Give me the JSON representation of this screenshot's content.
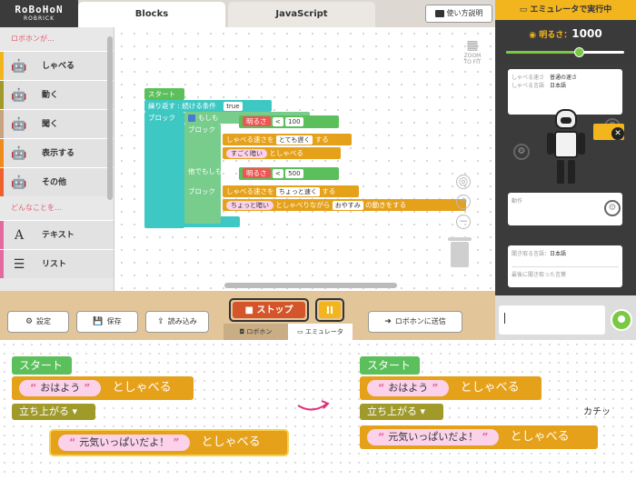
{
  "header": {
    "logo": "RoBoHoN",
    "logo_sub": "ROBRICK",
    "tabs": [
      "Blocks",
      "JavaScript"
    ],
    "howto": "使い方説明"
  },
  "sidebar": {
    "group1": "ロボホンが…",
    "items": [
      {
        "label": "しゃべる",
        "color": "#f3b51d",
        "icon": "robot-talk-icon"
      },
      {
        "label": "動く",
        "color": "#a09a2b",
        "icon": "robot-move-icon"
      },
      {
        "label": "聞く",
        "color": "#c9a37f",
        "icon": "robot-listen-icon"
      },
      {
        "label": "表示する",
        "color": "#f08a1a",
        "icon": "robot-display-icon"
      },
      {
        "label": "その他",
        "color": "#f0602a",
        "icon": "robot-other-icon"
      }
    ],
    "group2": "どんなことを…",
    "items2": [
      {
        "label": "テキスト",
        "color": "#e26a9f",
        "icon": "text-icon"
      },
      {
        "label": "リスト",
        "color": "#e26a9f",
        "icon": "list-icon"
      }
    ]
  },
  "workspace": {
    "start": "スタート",
    "repeat": "繰り返す : 続ける条件",
    "repeat_val": "true",
    "block": "ブロック",
    "if": "もしも",
    "do": "ブロック",
    "elseif": "他でもしも",
    "brightness": "明るさ",
    "lt": "<",
    "v100": "100",
    "v500": "500",
    "speak_speed": "しゃべる速さを",
    "speed_slow": "とても遅く",
    "suru": "する",
    "dark_text": "すごく暗い",
    "toshaberu": "としゃべる",
    "speed_fast": "ちょっと速く",
    "dim_text": "ちょっと暗い",
    "move_text": "としゃべりながら",
    "move_sel": "おやすみ",
    "move_end": "の動きをする",
    "tools_label": "ZOOM TO FIT"
  },
  "toolbar": {
    "settings": "設定",
    "save": "保存",
    "load": "読み込み",
    "stop": "ストップ",
    "pause": "II",
    "mode_robo": "ロボホン",
    "mode_emu": "エミュレータ",
    "send": "ロボホンに送信"
  },
  "emulator": {
    "title": "エミュレータで実行中",
    "brightness_label": "明るさ：",
    "brightness_value": "1000",
    "brightness_fraction": 0.62,
    "speed_key": "しゃべる速さ",
    "speed_val": "普通の速さ",
    "lang_key": "しゃべる言語",
    "lang_val": "日本語",
    "move_key": "動作",
    "listen_key": "聞き取る言語：",
    "listen_val": "日本語",
    "recognized_key": "最後に聞き取った言葉"
  },
  "tutorial": {
    "start": "スタート",
    "ohayou": "おはよう",
    "toshaberu": "としゃべる",
    "stand": "立ち上がる",
    "genki": "元気いっぱいだよ！",
    "kachi": "カチッ"
  }
}
